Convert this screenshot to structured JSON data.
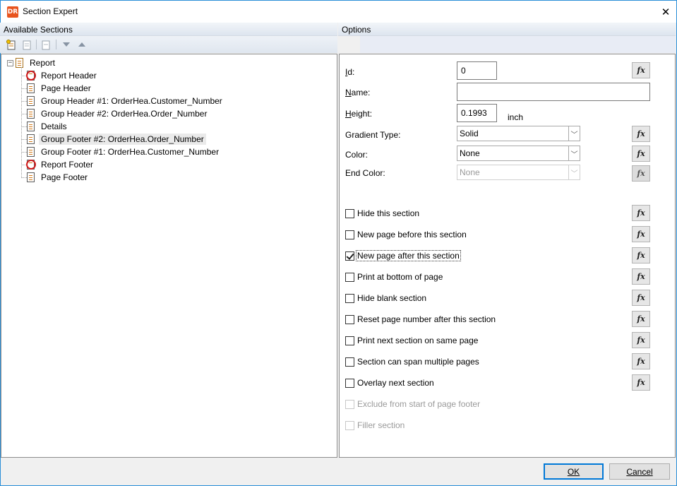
{
  "window": {
    "title": "Section Expert",
    "app_icon_text": "DR",
    "close_glyph": "✕"
  },
  "available_sections": {
    "header": "Available Sections",
    "toolbar": [
      {
        "icon": "insert-section-icon"
      },
      {
        "icon": "delete-section-icon"
      },
      {
        "icon": "merge-section-icon"
      },
      {
        "icon": "move-down-icon"
      },
      {
        "icon": "move-up-icon"
      }
    ],
    "tree": {
      "root_label": "Report",
      "expander": "−",
      "items": [
        {
          "label": "Report Header",
          "icon": "suppressed-section-icon"
        },
        {
          "label": "Page Header",
          "icon": "section-icon"
        },
        {
          "label": "Group Header #1: OrderHea.Customer_Number",
          "icon": "section-icon"
        },
        {
          "label": "Group Header #2: OrderHea.Order_Number",
          "icon": "section-icon"
        },
        {
          "label": "Details",
          "icon": "section-icon"
        },
        {
          "label": "Group Footer #2: OrderHea.Order_Number",
          "icon": "section-icon",
          "selected": true
        },
        {
          "label": "Group Footer #1: OrderHea.Customer_Number",
          "icon": "section-icon"
        },
        {
          "label": "Report Footer",
          "icon": "suppressed-section-icon"
        },
        {
          "label": "Page Footer",
          "icon": "section-icon"
        }
      ]
    }
  },
  "options": {
    "header": "Options",
    "id": {
      "label": "Id:",
      "value": "0"
    },
    "name": {
      "label": "Name:",
      "value": ""
    },
    "height": {
      "label": "Height:",
      "value": "0.1993",
      "unit": "inch"
    },
    "gradient_type": {
      "label": "Gradient Type:",
      "value": "Solid"
    },
    "color": {
      "label": "Color:",
      "value": "None"
    },
    "end_color": {
      "label": "End Color:",
      "value": "None",
      "disabled": true
    },
    "fx_label": "fx",
    "checkboxes": [
      {
        "label": "Hide this section",
        "checked": false
      },
      {
        "label": "New page before this section",
        "checked": false
      },
      {
        "label": "New page after this section",
        "checked": true
      },
      {
        "label": "Print at bottom of page",
        "checked": false
      },
      {
        "label": "Hide blank section",
        "checked": false
      },
      {
        "label": "Reset page number after this section",
        "checked": false
      },
      {
        "label": "Print next section on same page",
        "checked": false
      },
      {
        "label": "Section can span multiple pages",
        "checked": false
      },
      {
        "label": "Overlay next section",
        "checked": false
      },
      {
        "label": "Exclude from start of page footer",
        "checked": false,
        "disabled": true
      },
      {
        "label": "Filler section",
        "checked": false,
        "disabled": true
      }
    ]
  },
  "buttons": {
    "ok": "OK",
    "cancel": "Cancel"
  }
}
